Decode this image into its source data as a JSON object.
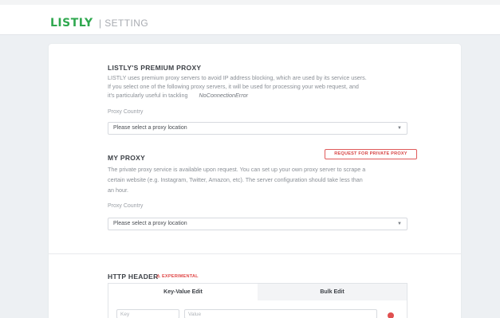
{
  "header": {
    "logo": "LISTLY",
    "page_label": "| SETTING"
  },
  "premium_proxy": {
    "title": "LISTLY'S PREMIUM PROXY",
    "description_line1": "LISTLY uses premium proxy servers to avoid IP address blocking, which are used by its service users.",
    "description_line2": "If you select one of the following proxy servers, it will be used for processing your web request, and",
    "description_line3": "it's particularly useful in tackling",
    "description_code": "NoConnectionError",
    "country_label": "Proxy Country",
    "select_value": "Please select a proxy location"
  },
  "my_proxy": {
    "title": "MY PROXY",
    "request_button": "REQUEST FOR PRIVATE PROXY",
    "description_line1": "The private proxy service is available upon request. You can set up your own proxy server to scrape a",
    "description_line2": "certain website (e.g. Instagram, Twitter, Amazon, etc). The server configuration should take less than",
    "description_line3": "an hour.",
    "country_label": "Proxy Country",
    "select_value": "Please select a proxy location"
  },
  "http_header": {
    "title": "HTTP HEADER",
    "badge": "⚠ EXPERIMENTAL",
    "tabs": [
      "Key-Value Edit",
      "Bulk Edit"
    ],
    "key_placeholder": "Key",
    "value_placeholder": "Value"
  },
  "icons": {
    "select_caret": "chevron-down-icon",
    "remove": "remove-row-icon",
    "warning": "warning-icon"
  },
  "colors": {
    "brand_green": "#2fa84f",
    "alert_red": "#d64545",
    "page_background": "#edf0f3"
  }
}
